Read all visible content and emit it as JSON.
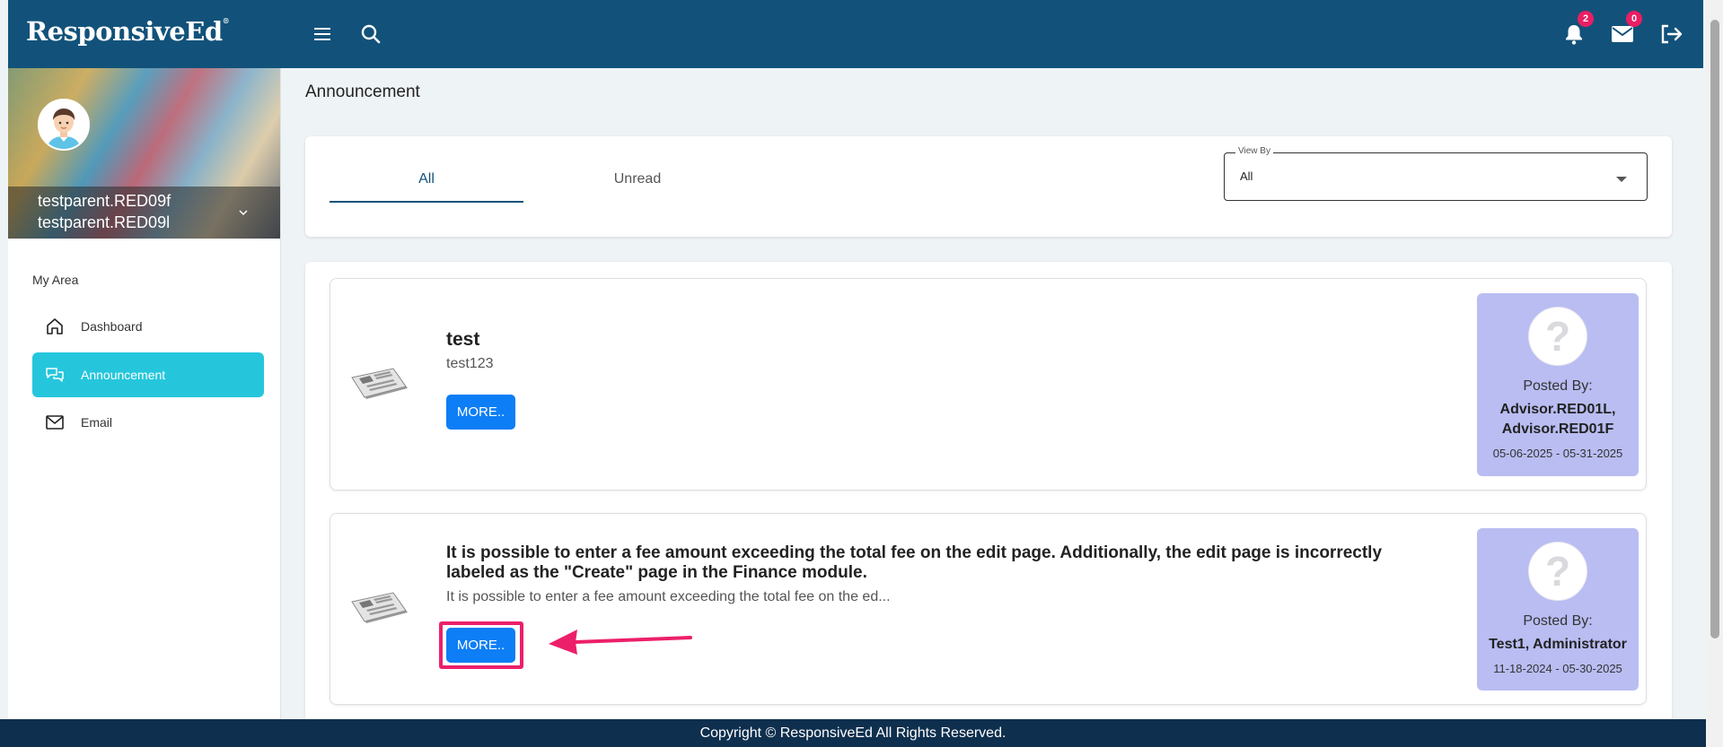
{
  "header": {
    "logo_text": "ResponsiveEd",
    "logo_mark": "®",
    "notifications_count": "2",
    "messages_count": "0",
    "icons": [
      "menu-icon",
      "search-icon",
      "bell-icon",
      "mail-icon",
      "logout-icon"
    ]
  },
  "sidebar": {
    "profile": {
      "line1": "testparent.RED09f",
      "line2": "testparent.RED09l"
    },
    "section_label": "My Area",
    "items": [
      {
        "label": "Dashboard",
        "icon": "home-icon"
      },
      {
        "label": "Announcement",
        "icon": "chat-icon",
        "active": true
      },
      {
        "label": "Email",
        "icon": "mail-icon"
      }
    ]
  },
  "main": {
    "page_title": "Announcement",
    "tabs": [
      {
        "label": "All",
        "active": true
      },
      {
        "label": "Unread"
      }
    ],
    "view_by": {
      "label": "View By",
      "value": "All"
    },
    "announcements": [
      {
        "title": "test",
        "description": "test123",
        "button_label": "MORE..",
        "posted_by_label": "Posted By:",
        "posted_by": "Advisor.RED01L, Advisor.RED01F",
        "date_range": "05-06-2025 - 05-31-2025"
      },
      {
        "title": "It is possible to enter a fee amount exceeding the total fee on the edit page. Additionally, the edit page is incorrectly labeled as the \"Create\" page in the Finance module.",
        "description": "It is possible to enter a fee amount exceeding the total fee on the ed...",
        "button_label": "MORE..",
        "posted_by_label": "Posted By:",
        "posted_by": "Test1, Administrator",
        "date_range": "11-18-2024 - 05-30-2025"
      }
    ]
  },
  "footer": {
    "text": "Copyright © ResponsiveEd All Rights Reserved."
  },
  "colors": {
    "header": "#12527a",
    "active_nav": "#25c6dc",
    "button": "#0d7ef5",
    "poster_bg": "#b9bdf2",
    "highlight": "#ec1f6a",
    "footer": "#0f2f4e"
  }
}
